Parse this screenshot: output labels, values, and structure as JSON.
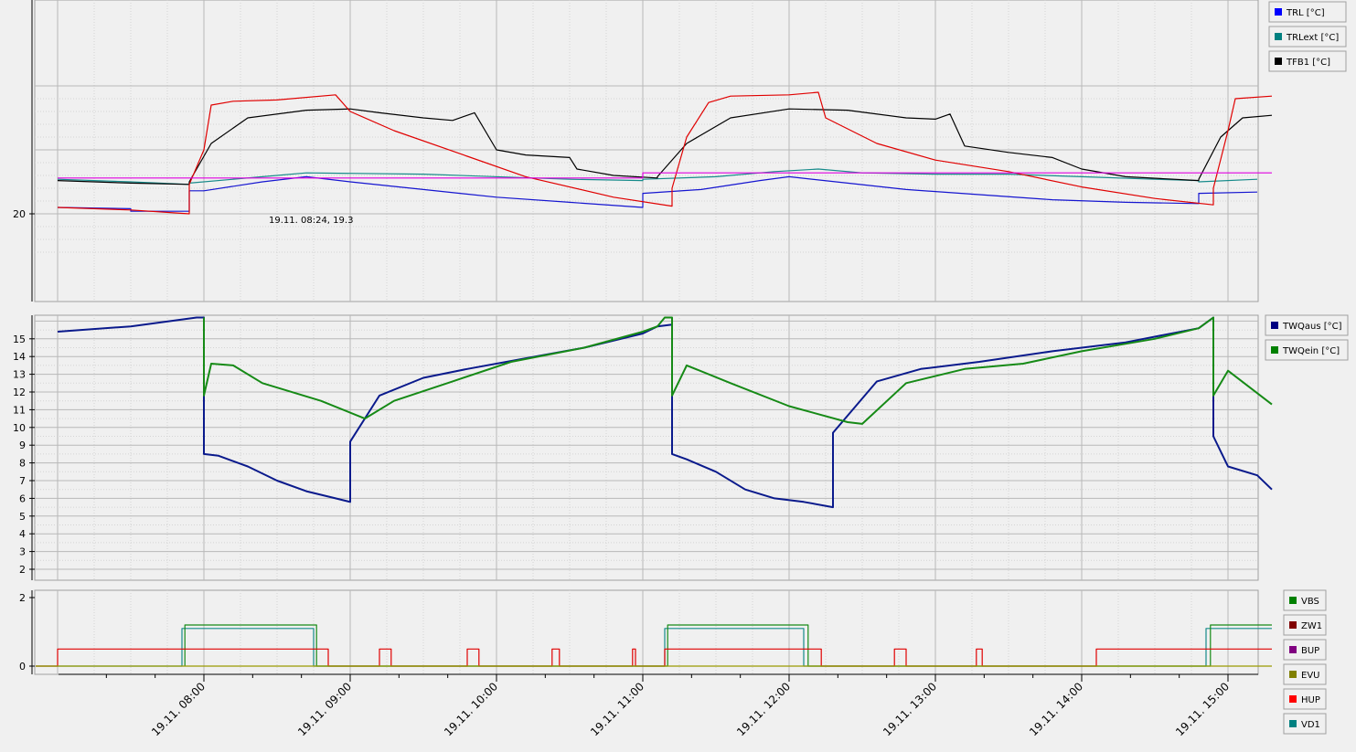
{
  "chart_data": [
    {
      "panel": "top",
      "type": "line",
      "yticks": [
        "20"
      ],
      "ylim": [
        17,
        30
      ],
      "x_unit": "hours",
      "annotation": "19.11. 08:24, 19.3",
      "legend": [
        {
          "name": "TRL [°C]",
          "color": "#0000ff"
        },
        {
          "name": "TRLext [°C]",
          "color": "#008080"
        },
        {
          "name": "TFB1 [°C]",
          "color": "#000000"
        }
      ],
      "series": [
        {
          "key": "TRL",
          "color": "#1515d0",
          "points": [
            [
              7.0,
              20.5
            ],
            [
              7.5,
              20.4
            ],
            [
              7.5,
              20.2
            ],
            [
              7.9,
              20.2
            ],
            [
              7.9,
              21.8
            ],
            [
              8.0,
              21.8
            ],
            [
              8.4,
              22.5
            ],
            [
              8.7,
              22.9
            ],
            [
              9.0,
              22.5
            ],
            [
              9.5,
              21.9
            ],
            [
              10.0,
              21.3
            ],
            [
              10.5,
              20.9
            ],
            [
              11.0,
              20.5
            ],
            [
              11.0,
              21.6
            ],
            [
              11.4,
              21.9
            ],
            [
              11.8,
              22.6
            ],
            [
              12.0,
              22.9
            ],
            [
              12.4,
              22.4
            ],
            [
              12.8,
              21.9
            ],
            [
              13.3,
              21.5
            ],
            [
              13.8,
              21.1
            ],
            [
              14.3,
              20.9
            ],
            [
              14.8,
              20.8
            ],
            [
              14.8,
              21.6
            ],
            [
              15.2,
              21.7
            ]
          ]
        },
        {
          "key": "TRLext",
          "color": "#168a8a",
          "points": [
            [
              7.0,
              22.7
            ],
            [
              7.5,
              22.5
            ],
            [
              7.9,
              22.3
            ],
            [
              7.9,
              22.4
            ],
            [
              8.4,
              22.9
            ],
            [
              8.7,
              23.2
            ],
            [
              9.5,
              23.1
            ],
            [
              10.5,
              22.7
            ],
            [
              11.0,
              22.6
            ],
            [
              11.0,
              22.7
            ],
            [
              11.5,
              22.9
            ],
            [
              11.9,
              23.3
            ],
            [
              12.2,
              23.5
            ],
            [
              12.5,
              23.2
            ],
            [
              13.0,
              23.1
            ],
            [
              13.5,
              23.1
            ],
            [
              14.0,
              22.9
            ],
            [
              14.5,
              22.7
            ],
            [
              14.8,
              22.6
            ],
            [
              14.8,
              22.5
            ],
            [
              15.2,
              22.7
            ]
          ]
        },
        {
          "key": "TFB1",
          "color": "#000000",
          "points": [
            [
              7.0,
              22.6
            ],
            [
              7.5,
              22.4
            ],
            [
              7.9,
              22.3
            ],
            [
              7.9,
              22.5
            ],
            [
              8.05,
              25.5
            ],
            [
              8.3,
              27.5
            ],
            [
              8.7,
              28.1
            ],
            [
              9.0,
              28.2
            ],
            [
              9.2,
              27.9
            ],
            [
              9.5,
              27.5
            ],
            [
              9.7,
              27.3
            ],
            [
              9.85,
              27.9
            ],
            [
              10.0,
              25.0
            ],
            [
              10.2,
              24.6
            ],
            [
              10.5,
              24.4
            ],
            [
              10.55,
              23.5
            ],
            [
              10.8,
              23.0
            ],
            [
              11.1,
              22.8
            ],
            [
              11.1,
              22.9
            ],
            [
              11.3,
              25.5
            ],
            [
              11.6,
              27.5
            ],
            [
              12.0,
              28.2
            ],
            [
              12.4,
              28.1
            ],
            [
              12.8,
              27.5
            ],
            [
              13.0,
              27.4
            ],
            [
              13.1,
              27.8
            ],
            [
              13.2,
              25.3
            ],
            [
              13.5,
              24.8
            ],
            [
              13.8,
              24.4
            ],
            [
              14.0,
              23.5
            ],
            [
              14.3,
              22.9
            ],
            [
              14.8,
              22.6
            ],
            [
              14.8,
              22.7
            ],
            [
              14.95,
              26.0
            ],
            [
              15.1,
              27.5
            ],
            [
              15.3,
              27.7
            ]
          ]
        },
        {
          "key": "TRL2",
          "color": "#e00000",
          "points": [
            [
              7.0,
              20.5
            ],
            [
              7.5,
              20.3
            ],
            [
              7.9,
              20.0
            ],
            [
              7.9,
              22.3
            ],
            [
              8.0,
              25.0
            ],
            [
              8.05,
              28.5
            ],
            [
              8.2,
              28.8
            ],
            [
              8.5,
              28.9
            ],
            [
              8.9,
              29.3
            ],
            [
              9.0,
              28.0
            ],
            [
              9.3,
              26.5
            ],
            [
              9.8,
              24.5
            ],
            [
              10.2,
              22.9
            ],
            [
              10.8,
              21.3
            ],
            [
              11.2,
              20.6
            ],
            [
              11.2,
              22.0
            ],
            [
              11.3,
              26.0
            ],
            [
              11.45,
              28.7
            ],
            [
              11.6,
              29.2
            ],
            [
              12.0,
              29.3
            ],
            [
              12.2,
              29.5
            ],
            [
              12.25,
              27.5
            ],
            [
              12.6,
              25.5
            ],
            [
              13.0,
              24.2
            ],
            [
              13.5,
              23.3
            ],
            [
              14.0,
              22.1
            ],
            [
              14.5,
              21.2
            ],
            [
              14.9,
              20.7
            ],
            [
              14.9,
              22.0
            ],
            [
              15.0,
              26.5
            ],
            [
              15.05,
              29.0
            ],
            [
              15.3,
              29.2
            ]
          ]
        },
        {
          "key": "ref",
          "color": "#e000e0",
          "points": [
            [
              7.0,
              22.8
            ],
            [
              11.0,
              22.8
            ],
            [
              11.0,
              23.2
            ],
            [
              15.3,
              23.2
            ]
          ]
        }
      ]
    },
    {
      "panel": "middle",
      "type": "line",
      "yticks": [
        "2",
        "3",
        "4",
        "5",
        "6",
        "7",
        "8",
        "9",
        "10",
        "11",
        "12",
        "13",
        "14",
        "15"
      ],
      "ylim": [
        1.5,
        16.2
      ],
      "legend": [
        {
          "name": "TWQaus [°C]",
          "color": "#000080"
        },
        {
          "name": "TWQein [°C]",
          "color": "#008000"
        }
      ],
      "series": [
        {
          "key": "TWQaus",
          "color": "#0a1a8c",
          "points": [
            [
              7.0,
              15.4
            ],
            [
              7.5,
              15.7
            ],
            [
              7.95,
              16.2
            ],
            [
              8.0,
              16.2
            ],
            [
              8.0,
              8.5
            ],
            [
              8.1,
              8.4
            ],
            [
              8.3,
              7.8
            ],
            [
              8.5,
              7.0
            ],
            [
              8.7,
              6.4
            ],
            [
              8.9,
              6.0
            ],
            [
              9.0,
              5.8
            ],
            [
              9.0,
              9.2
            ],
            [
              9.2,
              11.8
            ],
            [
              9.5,
              12.8
            ],
            [
              9.8,
              13.3
            ],
            [
              10.2,
              13.9
            ],
            [
              10.6,
              14.5
            ],
            [
              11.0,
              15.3
            ],
            [
              11.1,
              15.7
            ],
            [
              11.2,
              15.8
            ],
            [
              11.2,
              8.5
            ],
            [
              11.3,
              8.2
            ],
            [
              11.5,
              7.5
            ],
            [
              11.7,
              6.5
            ],
            [
              11.9,
              6.0
            ],
            [
              12.1,
              5.8
            ],
            [
              12.3,
              5.5
            ],
            [
              12.3,
              9.7
            ],
            [
              12.6,
              12.6
            ],
            [
              12.9,
              13.3
            ],
            [
              13.3,
              13.7
            ],
            [
              13.8,
              14.3
            ],
            [
              14.3,
              14.8
            ],
            [
              14.8,
              15.6
            ],
            [
              14.9,
              16.2
            ],
            [
              14.9,
              9.5
            ],
            [
              15.0,
              7.8
            ],
            [
              15.2,
              7.3
            ],
            [
              15.3,
              6.5
            ]
          ]
        },
        {
          "key": "TWQein",
          "color": "#168a16",
          "points": [
            [
              8.0,
              16.2
            ],
            [
              8.0,
              11.8
            ],
            [
              8.05,
              13.6
            ],
            [
              8.2,
              13.5
            ],
            [
              8.4,
              12.5
            ],
            [
              8.8,
              11.5
            ],
            [
              9.1,
              10.5
            ],
            [
              9.3,
              11.5
            ],
            [
              9.7,
              12.6
            ],
            [
              10.1,
              13.7
            ],
            [
              10.6,
              14.5
            ],
            [
              11.0,
              15.4
            ],
            [
              11.1,
              15.7
            ],
            [
              11.15,
              16.2
            ],
            [
              11.2,
              16.2
            ],
            [
              11.2,
              11.8
            ],
            [
              11.3,
              13.5
            ],
            [
              11.6,
              12.5
            ],
            [
              12.0,
              11.2
            ],
            [
              12.4,
              10.3
            ],
            [
              12.5,
              10.2
            ],
            [
              12.8,
              12.5
            ],
            [
              13.2,
              13.3
            ],
            [
              13.6,
              13.6
            ],
            [
              14.0,
              14.3
            ],
            [
              14.5,
              15.0
            ],
            [
              14.8,
              15.6
            ],
            [
              14.9,
              16.2
            ],
            [
              14.9,
              11.8
            ],
            [
              15.0,
              13.2
            ],
            [
              15.3,
              11.3
            ]
          ]
        }
      ]
    },
    {
      "panel": "bottom",
      "type": "line",
      "yticks": [
        "0",
        "2"
      ],
      "ylim": [
        -0.2,
        2.3
      ],
      "xticks": [
        "19.11. 08:00",
        "19.11. 09:00",
        "19.11. 10:00",
        "19.11. 11:00",
        "19.11. 12:00",
        "19.11. 13:00",
        "19.11. 14:00",
        "19.11. 15:00"
      ],
      "legend": [
        {
          "name": "VBS",
          "color": "#008000"
        },
        {
          "name": "ZW1",
          "color": "#800000"
        },
        {
          "name": "BUP",
          "color": "#800080"
        },
        {
          "name": "EVU",
          "color": "#808000"
        },
        {
          "name": "HUP",
          "color": "#ff0000"
        },
        {
          "name": "VD1",
          "color": "#008080"
        }
      ],
      "series": [
        {
          "key": "VD1",
          "color": "#168a8a",
          "points": [
            [
              6.85,
              0
            ],
            [
              7.85,
              0
            ],
            [
              7.85,
              1.1
            ],
            [
              8.75,
              1.1
            ],
            [
              8.75,
              0
            ],
            [
              11.15,
              0
            ],
            [
              11.15,
              1.1
            ],
            [
              12.1,
              1.1
            ],
            [
              12.1,
              0
            ],
            [
              14.85,
              0
            ],
            [
              14.85,
              1.1
            ],
            [
              15.3,
              1.1
            ]
          ]
        },
        {
          "key": "VBS",
          "color": "#168a16",
          "points": [
            [
              7.87,
              0
            ],
            [
              7.87,
              1.2
            ],
            [
              8.77,
              1.2
            ],
            [
              8.77,
              0
            ],
            [
              11.17,
              0
            ],
            [
              11.17,
              1.2
            ],
            [
              12.13,
              1.2
            ],
            [
              12.13,
              0
            ],
            [
              14.88,
              0
            ],
            [
              14.88,
              1.2
            ],
            [
              15.3,
              1.2
            ]
          ]
        },
        {
          "key": "HUP",
          "color": "#e00000",
          "points": [
            [
              6.85,
              0
            ],
            [
              7.0,
              0
            ],
            [
              7.0,
              0.5
            ],
            [
              8.85,
              0.5
            ],
            [
              8.85,
              0
            ],
            [
              9.2,
              0
            ],
            [
              9.2,
              0.5
            ],
            [
              9.28,
              0.5
            ],
            [
              9.28,
              0
            ],
            [
              9.8,
              0
            ],
            [
              9.8,
              0.5
            ],
            [
              9.88,
              0.5
            ],
            [
              9.88,
              0
            ],
            [
              10.38,
              0
            ],
            [
              10.38,
              0.5
            ],
            [
              10.43,
              0.5
            ],
            [
              10.43,
              0
            ],
            [
              10.93,
              0
            ],
            [
              10.93,
              0.5
            ],
            [
              10.95,
              0.5
            ],
            [
              10.95,
              0
            ],
            [
              11.15,
              0
            ],
            [
              11.15,
              0.5
            ],
            [
              12.22,
              0.5
            ],
            [
              12.22,
              0
            ],
            [
              12.72,
              0
            ],
            [
              12.72,
              0.5
            ],
            [
              12.8,
              0.5
            ],
            [
              12.8,
              0
            ],
            [
              13.28,
              0
            ],
            [
              13.28,
              0.5
            ],
            [
              13.32,
              0.5
            ],
            [
              13.32,
              0
            ],
            [
              14.1,
              0
            ],
            [
              14.1,
              0.5
            ],
            [
              15.3,
              0.5
            ]
          ]
        },
        {
          "key": "EVU",
          "color": "#9a9a00",
          "points": [
            [
              6.85,
              0
            ],
            [
              15.3,
              0
            ]
          ]
        }
      ]
    }
  ]
}
